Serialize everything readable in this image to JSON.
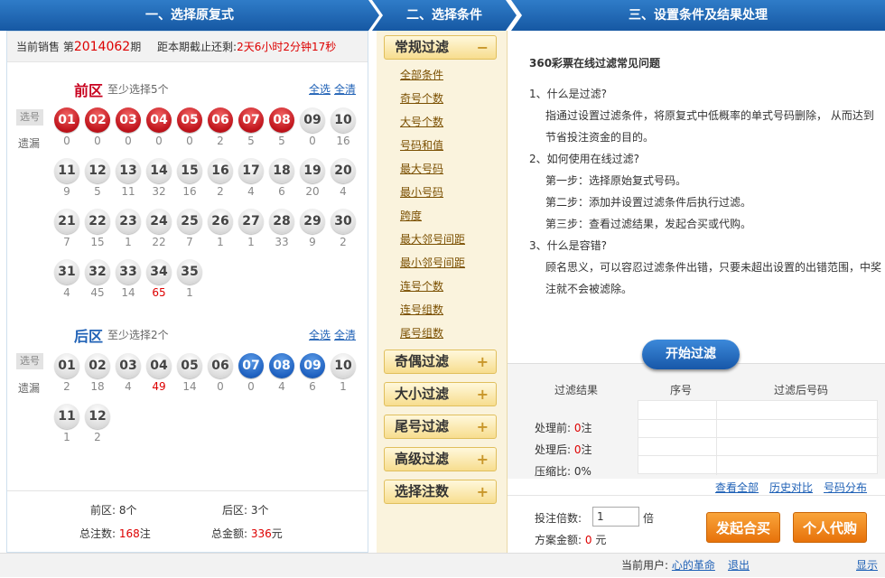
{
  "headers": {
    "step1": "一、选择原复式",
    "step2": "二、选择条件",
    "step3": "三、设置条件及结果处理"
  },
  "sale": {
    "prefix": "当前销售 第",
    "issue": "2014062",
    "suffix": "期",
    "deadline_label": "距本期截止还剩:",
    "deadline_value": "2天6小时2分钟17秒"
  },
  "front": {
    "title": "前区",
    "hint": "至少选择5个",
    "select_all": "全选",
    "clear_all": "全清",
    "pick_label": "选号",
    "miss_label": "遗漏",
    "balls": [
      {
        "n": "01",
        "miss": "0",
        "sel": true
      },
      {
        "n": "02",
        "miss": "0",
        "sel": true
      },
      {
        "n": "03",
        "miss": "0",
        "sel": true
      },
      {
        "n": "04",
        "miss": "0",
        "sel": true
      },
      {
        "n": "05",
        "miss": "0",
        "sel": true
      },
      {
        "n": "06",
        "miss": "2",
        "sel": true
      },
      {
        "n": "07",
        "miss": "5",
        "sel": true
      },
      {
        "n": "08",
        "miss": "5",
        "sel": true
      },
      {
        "n": "09",
        "miss": "0",
        "sel": false
      },
      {
        "n": "10",
        "miss": "16",
        "sel": false
      },
      {
        "n": "11",
        "miss": "9",
        "sel": false
      },
      {
        "n": "12",
        "miss": "5",
        "sel": false
      },
      {
        "n": "13",
        "miss": "11",
        "sel": false
      },
      {
        "n": "14",
        "miss": "32",
        "sel": false
      },
      {
        "n": "15",
        "miss": "16",
        "sel": false
      },
      {
        "n": "16",
        "miss": "2",
        "sel": false
      },
      {
        "n": "17",
        "miss": "4",
        "sel": false
      },
      {
        "n": "18",
        "miss": "6",
        "sel": false
      },
      {
        "n": "19",
        "miss": "20",
        "sel": false
      },
      {
        "n": "20",
        "miss": "4",
        "sel": false
      },
      {
        "n": "21",
        "miss": "7",
        "sel": false
      },
      {
        "n": "22",
        "miss": "15",
        "sel": false
      },
      {
        "n": "23",
        "miss": "1",
        "sel": false
      },
      {
        "n": "24",
        "miss": "22",
        "sel": false
      },
      {
        "n": "25",
        "miss": "7",
        "sel": false
      },
      {
        "n": "26",
        "miss": "1",
        "sel": false
      },
      {
        "n": "27",
        "miss": "1",
        "sel": false
      },
      {
        "n": "28",
        "miss": "33",
        "sel": false
      },
      {
        "n": "29",
        "miss": "9",
        "sel": false
      },
      {
        "n": "30",
        "miss": "2",
        "sel": false
      },
      {
        "n": "31",
        "miss": "4",
        "sel": false
      },
      {
        "n": "32",
        "miss": "45",
        "sel": false
      },
      {
        "n": "33",
        "miss": "14",
        "sel": false
      },
      {
        "n": "34",
        "miss": "65",
        "sel": false,
        "hot": true
      },
      {
        "n": "35",
        "miss": "1",
        "sel": false
      }
    ]
  },
  "back": {
    "title": "后区",
    "hint": "至少选择2个",
    "select_all": "全选",
    "clear_all": "全清",
    "pick_label": "选号",
    "miss_label": "遗漏",
    "balls": [
      {
        "n": "01",
        "miss": "2",
        "sel": false
      },
      {
        "n": "02",
        "miss": "18",
        "sel": false
      },
      {
        "n": "03",
        "miss": "4",
        "sel": false
      },
      {
        "n": "04",
        "miss": "49",
        "sel": false,
        "hot": true
      },
      {
        "n": "05",
        "miss": "14",
        "sel": false
      },
      {
        "n": "06",
        "miss": "0",
        "sel": false
      },
      {
        "n": "07",
        "miss": "0",
        "sel": true
      },
      {
        "n": "08",
        "miss": "4",
        "sel": true
      },
      {
        "n": "09",
        "miss": "6",
        "sel": true
      },
      {
        "n": "10",
        "miss": "1",
        "sel": false
      },
      {
        "n": "11",
        "miss": "1",
        "sel": false
      },
      {
        "n": "12",
        "miss": "2",
        "sel": false
      }
    ]
  },
  "summary": {
    "front_label": "前区:",
    "front_value": "8个",
    "back_label": "后区:",
    "back_value": "3个",
    "notes_label": "总注数:",
    "notes_value": "168",
    "notes_unit": "注",
    "amount_label": "总金额:",
    "amount_value": "336",
    "amount_unit": "元"
  },
  "filters": {
    "general": {
      "label": "常规过滤",
      "expanded": true,
      "items": [
        "全部条件",
        "奇号个数",
        "大号个数",
        "号码和值",
        "最大号码",
        "最小号码",
        "跨度",
        "最大邻号间距",
        "最小邻号间距",
        "连号个数",
        "连号组数",
        "尾号组数"
      ]
    },
    "collapsed": [
      "奇偶过滤",
      "大小过滤",
      "尾号过滤",
      "高级过滤",
      "选择注数"
    ]
  },
  "faq": {
    "title": "360彩票在线过滤常见问题",
    "q1": "1、什么是过滤?",
    "a1": "指通过设置过滤条件，将原复式中低概率的单式号码删除， 从而达到节省投注资金的目的。",
    "q2": "2、如何使用在线过滤?",
    "a2_1": "第一步：选择原始复式号码。",
    "a2_2": "第二步：添加并设置过滤条件后执行过滤。",
    "a2_3": "第三步：查看过滤结果，发起合买或代购。",
    "q3": "3、什么是容错?",
    "a3": "顾名思义，可以容忍过滤条件出错，只要未超出设置的出错范围，中奖注就不会被滤除。"
  },
  "start_button": "开始过滤",
  "result": {
    "col1": "过滤结果",
    "col2": "序号",
    "col3": "过滤后号码",
    "before_label": "处理前:",
    "before_value": "0",
    "before_unit": "注",
    "after_label": "处理后:",
    "after_value": "0",
    "after_unit": "注",
    "ratio_label": "压缩比:",
    "ratio_value": "0%",
    "view_all": "查看全部",
    "history": "历史对比",
    "distribution": "号码分布"
  },
  "bet": {
    "multiple_label": "投注倍数:",
    "multiple_value": "1",
    "multiple_unit": "倍",
    "amount_label": "方案金额:",
    "amount_value": "0",
    "amount_unit": "元",
    "group_buy": "发起合买",
    "personal_buy": "个人代购"
  },
  "footer": {
    "user_label": "当前用户:",
    "user_name": "心的革命",
    "logout": "退出",
    "show": "显示"
  }
}
